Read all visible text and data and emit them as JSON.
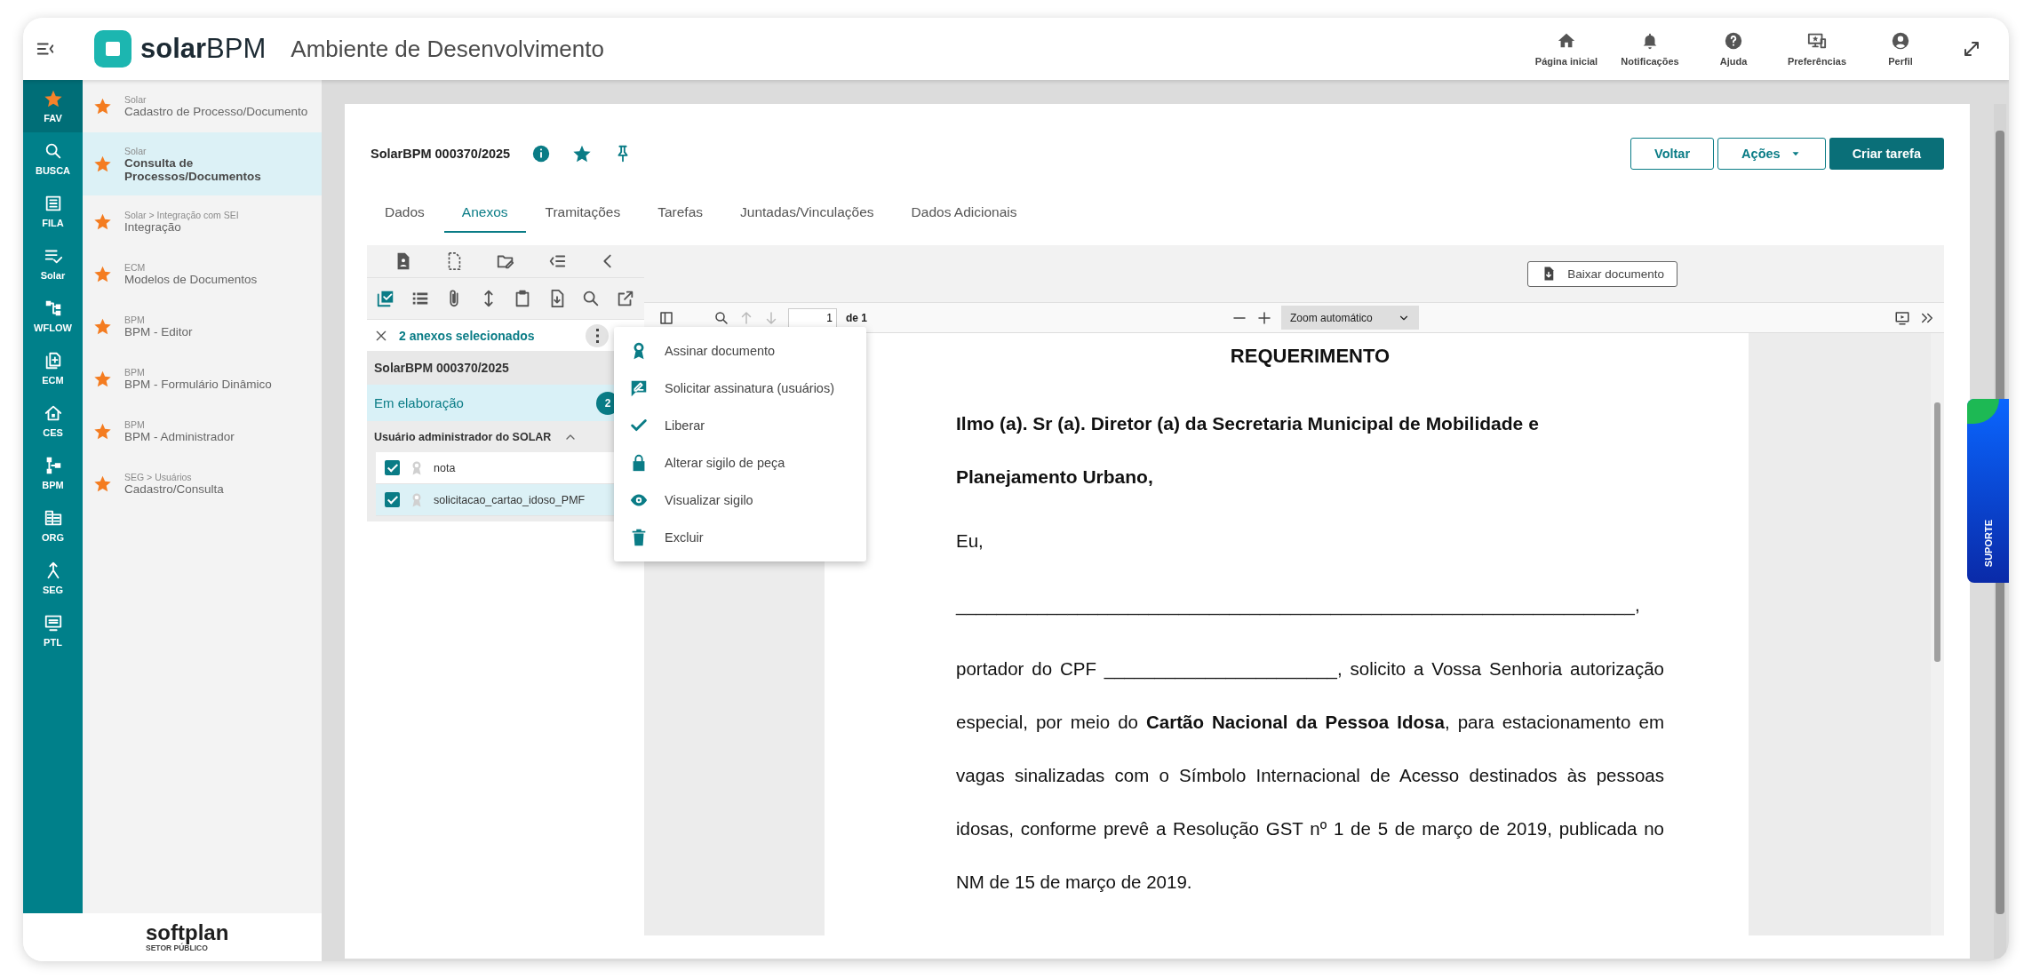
{
  "header": {
    "logo_bold": "solar",
    "logo_light": "BPM",
    "environment": "Ambiente de Desenvolvimento",
    "actions": [
      {
        "label": "Página inicial"
      },
      {
        "label": "Notificações"
      },
      {
        "label": "Ajuda"
      },
      {
        "label": "Preferências"
      },
      {
        "label": "Perfil"
      }
    ]
  },
  "rail": [
    {
      "label": "FAV",
      "selected": true
    },
    {
      "label": "BUSCA",
      "selected": false
    },
    {
      "label": "FILA",
      "selected": false
    },
    {
      "label": "Solar",
      "selected": false
    },
    {
      "label": "WFLOW",
      "selected": false
    },
    {
      "label": "ECM",
      "selected": false
    },
    {
      "label": "CES",
      "selected": false
    },
    {
      "label": "BPM",
      "selected": false
    },
    {
      "label": "ORG",
      "selected": false
    },
    {
      "label": "SEG",
      "selected": false
    },
    {
      "label": "PTL",
      "selected": false
    }
  ],
  "favorites": [
    {
      "path": "Solar",
      "title": "Cadastro de Processo/Documento",
      "selected": false
    },
    {
      "path": "Solar",
      "title": "Consulta de Processos/Documentos",
      "selected": true
    },
    {
      "path": "Solar > Integração com SEI",
      "title": "Integração",
      "selected": false
    },
    {
      "path": "ECM",
      "title": "Modelos de Documentos",
      "selected": false
    },
    {
      "path": "BPM",
      "title": "BPM - Editor",
      "selected": false
    },
    {
      "path": "BPM",
      "title": "BPM - Formulário Dinâmico",
      "selected": false
    },
    {
      "path": "BPM",
      "title": "BPM - Administrador",
      "selected": false
    },
    {
      "path": "SEG > Usuários",
      "title": "Cadastro/Consulta",
      "selected": false
    }
  ],
  "footer_logo": {
    "name": "softplan",
    "subtitle": "SETOR PÚBLICO"
  },
  "process": {
    "title": "SolarBPM 000370/2025"
  },
  "buttons": [
    {
      "label": "Voltar",
      "kind": "outline"
    },
    {
      "label": "Ações",
      "kind": "dropdown"
    },
    {
      "label": "Criar tarefa",
      "kind": "primary"
    }
  ],
  "tabs": [
    {
      "label": "Dados",
      "selected": false
    },
    {
      "label": "Anexos",
      "selected": true
    },
    {
      "label": "Tramitações",
      "selected": false
    },
    {
      "label": "Tarefas",
      "selected": false
    },
    {
      "label": "Juntadas/Vinculações",
      "selected": false
    },
    {
      "label": "Dados Adicionais",
      "selected": false
    }
  ],
  "attachments": {
    "selection_text": "2 anexos selecionados",
    "process_header": "SolarBPM 000370/2025",
    "status_group": {
      "label": "Em elaboração",
      "count": "2"
    },
    "user_group": {
      "label": "Usuário administrador do SOLAR",
      "expanded": true
    },
    "files": [
      {
        "name": "nota",
        "checked": true,
        "selected": false
      },
      {
        "name": "solicitacao_cartao_idoso_PMF",
        "checked": true,
        "selected": true
      }
    ]
  },
  "context_menu": [
    {
      "label": "Assinar documento"
    },
    {
      "label": "Solicitar assinatura (usuários)"
    },
    {
      "label": "Liberar"
    },
    {
      "label": "Alterar sigilo de peça"
    },
    {
      "label": "Visualizar sigilo"
    },
    {
      "label": "Excluir"
    }
  ],
  "viewer": {
    "download_label": "Baixar documento",
    "page_number": "1",
    "page_total": "de 1",
    "zoom": "Zoom automático",
    "document": {
      "title": "REQUERIMENTO",
      "paragraphs": [
        {
          "kind": "bold",
          "text": "Ilmo (a). Sr (a). Diretor (a) da Secretaria Municipal de Mobilidade e Planejamento Urbano,"
        },
        {
          "kind": "text",
          "text": "Eu,"
        },
        {
          "kind": "text",
          "text": "___________________________________________________________________,"
        },
        {
          "kind": "text",
          "text": "portador do CPF _______________________, solicito a Vossa Senhoria autorização especial, por meio do **Cartão Nacional da Pessoa Idosa**, para estacionamento em vagas sinalizadas com o Símbolo Internacional de Acesso destinados às pessoas idosas, conforme prevê a Resolução GST nº 1 de 5 de março de 2019, publicada no NM de 15 de março de 2019."
        }
      ]
    }
  },
  "support_tab": "SUPORTE"
}
